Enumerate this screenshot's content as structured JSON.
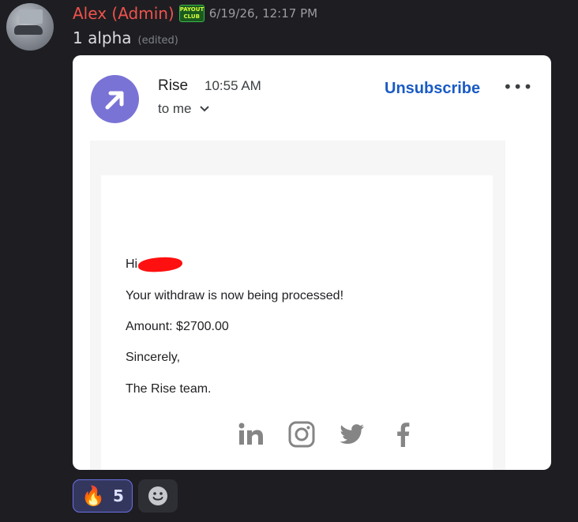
{
  "message": {
    "author": "Alex (Admin)",
    "role_badge_lines": [
      "PAYOUT",
      "CLUB"
    ],
    "timestamp": "6/19/26, 12:17 PM",
    "text": "1 alpha",
    "edited_label": "(edited)"
  },
  "email": {
    "sender": "Rise",
    "time": "10:55 AM",
    "recipient": "to me",
    "unsubscribe_label": "Unsubscribe",
    "more_label": "•••",
    "greeting": "Hi",
    "line1": "Your withdraw is now being processed!",
    "amount_label": "Amount:",
    "amount_value": "$2700.00",
    "closing": "Sincerely,",
    "signature": "The Rise team.",
    "social_icons": [
      "linkedin-icon",
      "instagram-icon",
      "twitter-icon",
      "facebook-icon"
    ],
    "brand_color": "#7a73d6",
    "link_color": "#1a5bc4"
  },
  "reactions": [
    {
      "emoji": "🔥",
      "count": "5"
    }
  ],
  "colors": {
    "author": "#f0524c",
    "background": "#1e1e22",
    "reaction_active": "#6a6fe6"
  }
}
